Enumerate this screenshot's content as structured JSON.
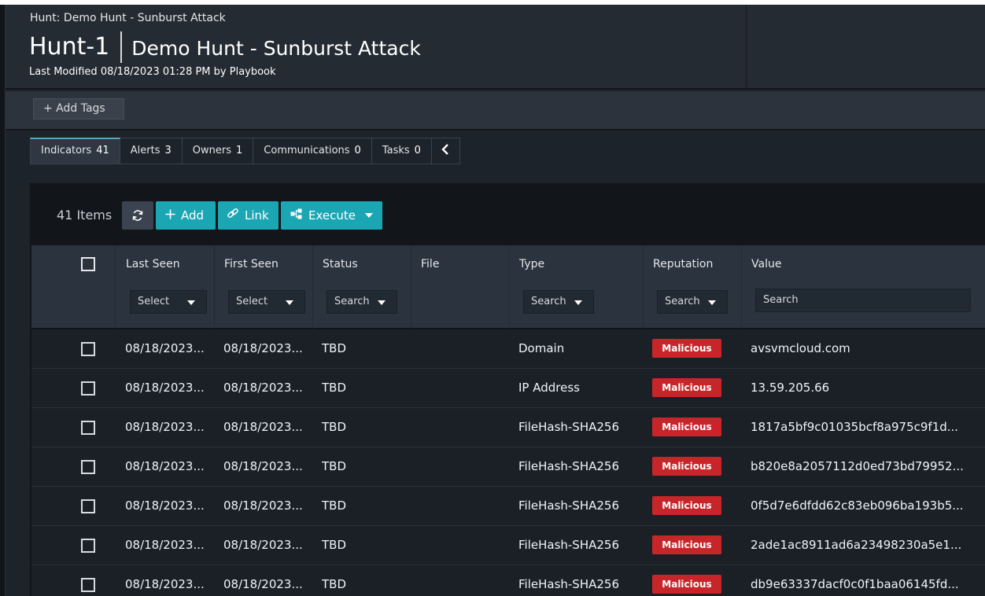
{
  "header": {
    "breadcrumb": "Hunt: Demo Hunt - Sunburst Attack",
    "hunt_id": "Hunt-1",
    "hunt_name": "Demo Hunt - Sunburst Attack",
    "last_modified": "Last Modified 08/18/2023 01:28 PM by Playbook"
  },
  "tags": {
    "add_label": "+ Add Tags"
  },
  "tabs": [
    {
      "label": "Indicators",
      "count": "41",
      "active": true
    },
    {
      "label": "Alerts",
      "count": "3"
    },
    {
      "label": "Owners",
      "count": "1"
    },
    {
      "label": "Communications",
      "count": "0"
    },
    {
      "label": "Tasks",
      "count": "0"
    }
  ],
  "tab_collapse_icon": "chevron-left-icon",
  "toolbar": {
    "items_count": "41 Items",
    "refresh_icon": "refresh-icon",
    "add_label": "Add",
    "link_label": "Link",
    "execute_label": "Execute"
  },
  "columns": [
    {
      "label": "Last Seen",
      "filter": "Select"
    },
    {
      "label": "First Seen",
      "filter": "Select"
    },
    {
      "label": "Status",
      "filter": "Search"
    },
    {
      "label": "File",
      "filter": ""
    },
    {
      "label": "Type",
      "filter": "Search"
    },
    {
      "label": "Reputation",
      "filter": "Search"
    },
    {
      "label": "Value",
      "filter": "Search"
    }
  ],
  "rows": [
    {
      "last_seen": "08/18/2023...",
      "first_seen": "08/18/2023...",
      "status": "TBD",
      "file": "",
      "type": "Domain",
      "reputation": "Malicious",
      "value": "avsvmcloud.com"
    },
    {
      "last_seen": "08/18/2023...",
      "first_seen": "08/18/2023...",
      "status": "TBD",
      "file": "",
      "type": "IP Address",
      "reputation": "Malicious",
      "value": "13.59.205.66"
    },
    {
      "last_seen": "08/18/2023...",
      "first_seen": "08/18/2023...",
      "status": "TBD",
      "file": "",
      "type": "FileHash-SHA256",
      "reputation": "Malicious",
      "value": "1817a5bf9c01035bcf8a975c9f1d..."
    },
    {
      "last_seen": "08/18/2023...",
      "first_seen": "08/18/2023...",
      "status": "TBD",
      "file": "",
      "type": "FileHash-SHA256",
      "reputation": "Malicious",
      "value": "b820e8a2057112d0ed73bd79952..."
    },
    {
      "last_seen": "08/18/2023...",
      "first_seen": "08/18/2023...",
      "status": "TBD",
      "file": "",
      "type": "FileHash-SHA256",
      "reputation": "Malicious",
      "value": "0f5d7e6dfdd62c83eb096ba193b5..."
    },
    {
      "last_seen": "08/18/2023...",
      "first_seen": "08/18/2023...",
      "status": "TBD",
      "file": "",
      "type": "FileHash-SHA256",
      "reputation": "Malicious",
      "value": "2ade1ac8911ad6a23498230a5e1..."
    },
    {
      "last_seen": "08/18/2023...",
      "first_seen": "08/18/2023...",
      "status": "TBD",
      "file": "",
      "type": "FileHash-SHA256",
      "reputation": "Malicious",
      "value": "db9e63337dacf0c0f1baa06145fd..."
    }
  ],
  "colors": {
    "accent": "#1ba6b4",
    "malicious": "#c6262a",
    "background": "#1d232a"
  }
}
